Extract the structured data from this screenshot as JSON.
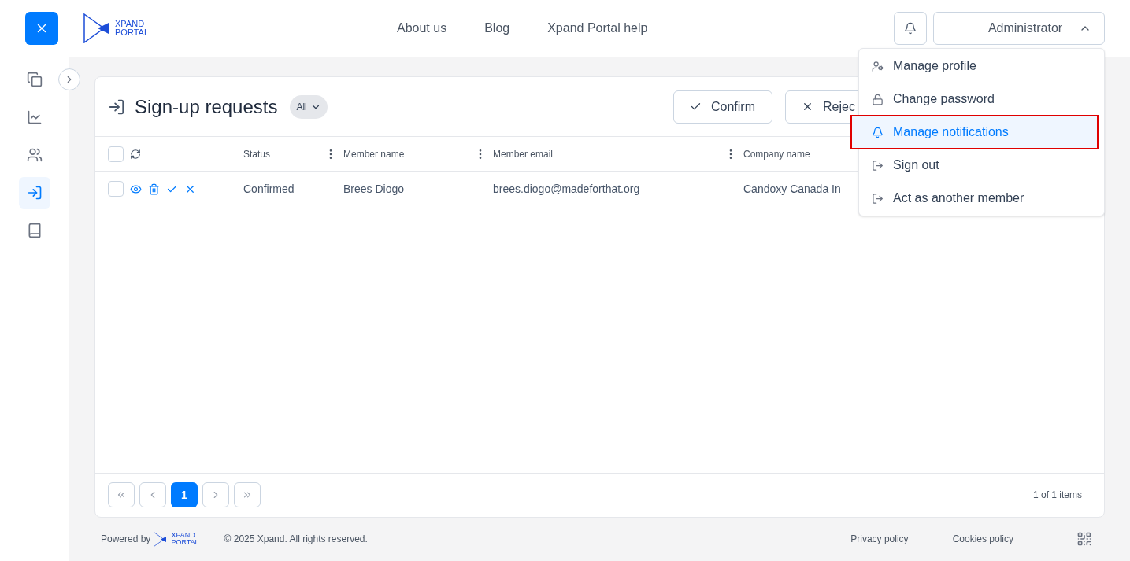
{
  "header": {
    "logo": {
      "line1": "XPAND",
      "line2": "PORTAL"
    },
    "nav": [
      "About us",
      "Blog",
      "Xpand Portal help"
    ],
    "user_menu": {
      "label": "Administrator",
      "expanded": true
    }
  },
  "sidebar": {
    "items": [
      {
        "selected": false
      },
      {
        "selected": false
      },
      {
        "selected": false
      },
      {
        "selected": true
      },
      {
        "selected": false
      }
    ]
  },
  "dropdown": {
    "items": [
      {
        "label": "Manage profile",
        "selected": false,
        "highlighted": false
      },
      {
        "label": "Change password",
        "selected": false,
        "highlighted": false
      },
      {
        "label": "Manage notifications",
        "selected": true,
        "highlighted": true
      },
      {
        "label": "Sign out",
        "selected": false,
        "highlighted": false
      },
      {
        "label": "Act as another member",
        "selected": false,
        "highlighted": false
      }
    ]
  },
  "page": {
    "title": "Sign-up requests",
    "filter": "All",
    "buttons": [
      {
        "kind": "confirm",
        "label": "Confirm"
      },
      {
        "kind": "reject",
        "label": "Rejec"
      }
    ]
  },
  "table": {
    "all_checked": false,
    "columns": [
      "Status",
      "Member name",
      "Member email",
      "Company name"
    ],
    "rows": [
      {
        "checked": false,
        "cells": [
          "Confirmed",
          "Brees Diogo",
          "brees.diogo@madeforthat.org",
          "Candoxy Canada In"
        ]
      }
    ]
  },
  "pagination": {
    "pages": [
      {
        "label": "1",
        "selected": true
      }
    ],
    "summary": "1 of 1 items"
  },
  "footer": {
    "powered_by": "Powered by",
    "logo": {
      "line1": "XPAND",
      "line2": "PORTAL"
    },
    "copyright": "© 2025 Xpand. All rights reserved.",
    "links": [
      "Privacy policy",
      "Cookies policy"
    ]
  }
}
